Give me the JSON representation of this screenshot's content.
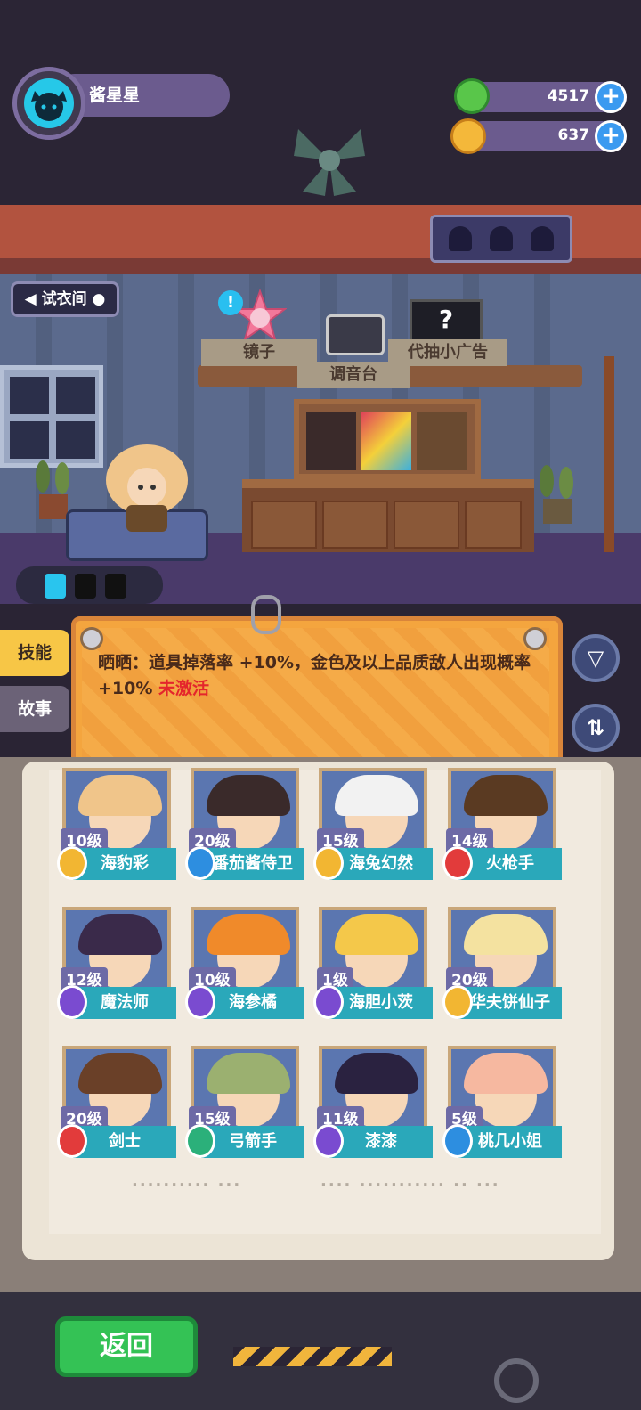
{
  "player": {
    "name": "酱星星",
    "avatar_icon": "cat-icon"
  },
  "currency": [
    {
      "icon": "green-gem-coin-icon",
      "value": "4517",
      "color": "#59c64a"
    },
    {
      "icon": "gold-planet-coin-icon",
      "value": "637",
      "color": "#f4b83a"
    }
  ],
  "room": {
    "name": "试衣间",
    "furniture_labels": [
      "镜子",
      "调音台",
      "代抽小广告"
    ],
    "ad_symbol": "?"
  },
  "side_tabs": [
    {
      "label": "技能",
      "active": true
    },
    {
      "label": "故事",
      "active": false
    }
  ],
  "skill": {
    "text": "晒晒：道具掉落率 +10%，金色及以上品质敌人出现概率 +10%",
    "status": "未激活",
    "status_color": "#e4252c"
  },
  "controls": {
    "filter_icon": "filter-icon",
    "sort_icon": "sort-arrows-icon",
    "back_label": "返回"
  },
  "roster": [
    {
      "level": "10级",
      "name": "海豹彩",
      "badge_color": "#f2b632",
      "hair": "#f0c58a"
    },
    {
      "level": "20级",
      "name": "番茄酱侍卫",
      "badge_color": "#2d8ee0",
      "hair": "#3a2a2a"
    },
    {
      "level": "15级",
      "name": "海兔幻然",
      "badge_color": "#f2b632",
      "hair": "#f2f2f2"
    },
    {
      "level": "14级",
      "name": "火枪手",
      "badge_color": "#e23b3b",
      "hair": "#5a3a22"
    },
    {
      "level": "12级",
      "name": "魔法师",
      "badge_color": "#7a4bd0",
      "hair": "#3a2a4a"
    },
    {
      "level": "10级",
      "name": "海参橘",
      "badge_color": "#7a4bd0",
      "hair": "#f08a2a"
    },
    {
      "level": "1级",
      "name": "海胆小茨",
      "badge_color": "#7a4bd0",
      "hair": "#f4c84a"
    },
    {
      "level": "20级",
      "name": "华夫饼仙子",
      "badge_color": "#f2b632",
      "hair": "#f4e2a0"
    },
    {
      "level": "20级",
      "name": "剑士",
      "badge_color": "#e23b3b",
      "hair": "#6a4028"
    },
    {
      "level": "15级",
      "name": "弓箭手",
      "badge_color": "#2bb07a",
      "hair": "#9bb070"
    },
    {
      "level": "11级",
      "name": "漆漆",
      "badge_color": "#7a4bd0",
      "hair": "#2a2240"
    },
    {
      "level": "5级",
      "name": "桃几小姐",
      "badge_color": "#2d8ee0",
      "hair": "#f6b8a0"
    }
  ]
}
